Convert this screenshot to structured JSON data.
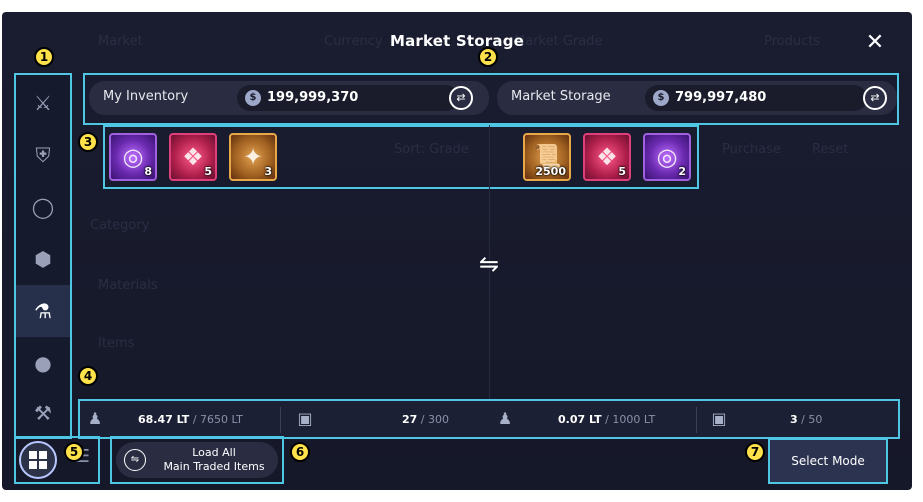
{
  "window": {
    "title": "Market Storage",
    "close_symbol": "✕",
    "background_labels": [
      "Market",
      "Currency",
      "Market Grade",
      "Products",
      "Category",
      "Materials",
      "Items",
      "Sort: Grade",
      "Purchase",
      "Reset"
    ]
  },
  "sidebar": {
    "items": [
      {
        "icon": "crossed-swords-icon",
        "glyph": "⚔"
      },
      {
        "icon": "armor-icon",
        "glyph": "⛨"
      },
      {
        "icon": "ring-icon",
        "glyph": "◯"
      },
      {
        "icon": "gem-icon",
        "glyph": "⬢"
      },
      {
        "icon": "potion-icon",
        "glyph": "⚗"
      },
      {
        "icon": "bomb-icon",
        "glyph": "●"
      },
      {
        "icon": "tools-icon",
        "glyph": "⚒"
      }
    ],
    "active_index": 4
  },
  "inventory": {
    "label": "My Inventory",
    "coin_symbol": "$",
    "balance": "199,999,370",
    "swap_symbol": "⇄",
    "items": [
      {
        "name": "purple-orb",
        "rarity": "purple",
        "glyph": "◎",
        "qty": "8"
      },
      {
        "name": "crystal-shard",
        "rarity": "red",
        "glyph": "❖",
        "qty": "5"
      },
      {
        "name": "amethyst-cluster",
        "rarity": "gold",
        "glyph": "✦",
        "qty": "3"
      }
    ],
    "weight_current": "68.47 LT",
    "weight_max": " / 7650 LT",
    "slots_current": "27",
    "slots_max": " / 300"
  },
  "storage": {
    "label": "Market Storage",
    "coin_symbol": "$",
    "balance": "799,997,480",
    "swap_symbol": "⇄",
    "items": [
      {
        "name": "scroll",
        "rarity": "gold",
        "glyph": "📜",
        "qty": "2500"
      },
      {
        "name": "crystal-shard",
        "rarity": "red",
        "glyph": "❖",
        "qty": "5"
      },
      {
        "name": "purple-orb",
        "rarity": "purple",
        "glyph": "◎",
        "qty": "2"
      }
    ],
    "weight_current": "0.07 LT",
    "weight_max": " / 1000 LT",
    "slots_current": "3",
    "slots_max": " / 50"
  },
  "center_swap_symbol": "⇋",
  "icons": {
    "weight": "♟",
    "slots": "▣",
    "list": "☰"
  },
  "load_all": {
    "line1": "Load All",
    "line2": "Main Traded Items",
    "swap_symbol": "⇋"
  },
  "select_mode_label": "Select Mode",
  "markers": [
    "1",
    "2",
    "3",
    "4",
    "5",
    "6",
    "7"
  ],
  "colors": {
    "highlight": "#4fc6e4",
    "marker": "#ffe14a",
    "panel": "#2a2d42",
    "background": "#1a1d30"
  }
}
